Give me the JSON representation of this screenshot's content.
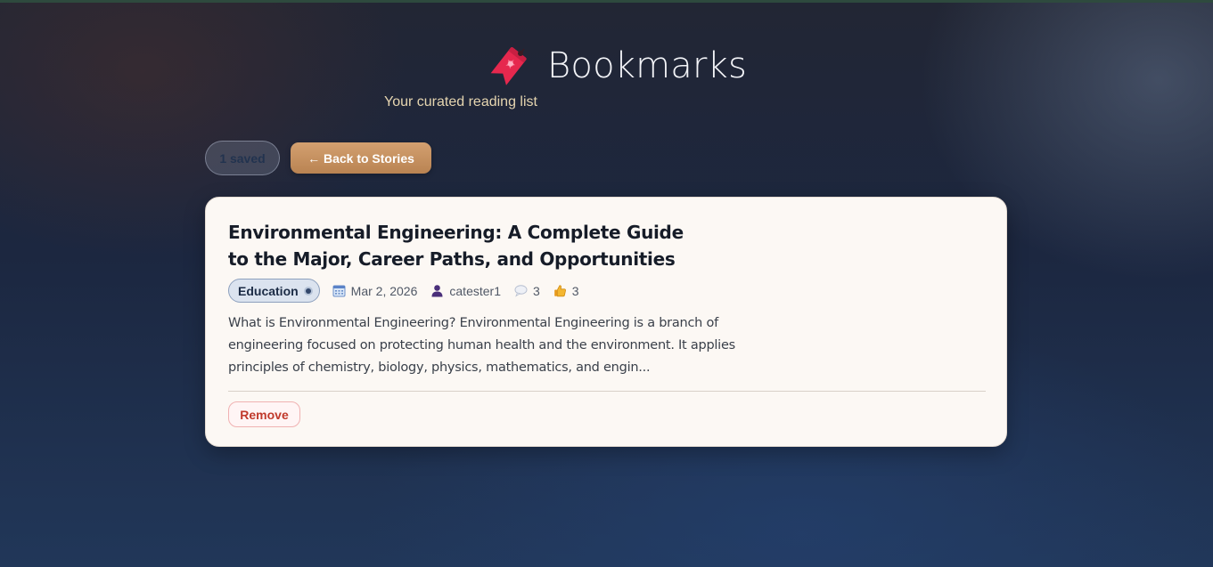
{
  "header": {
    "title": "Bookmarks",
    "subtitle": "Your curated reading list",
    "icon": "bookmark-icon"
  },
  "toolbar": {
    "saved_count": "1 saved",
    "back_label": "← Back to Stories"
  },
  "bookmarks": [
    {
      "title": "Environmental Engineering: A Complete Guide to the Major, Career Paths, and Opportunities",
      "category": "Education",
      "date": "Mar 2, 2026",
      "author": "catester1",
      "comments": "3",
      "likes": "3",
      "excerpt": "What is Environmental Engineering? Environmental Engineering is a branch of engineering focused on protecting human health and the environment. It applies principles of chemistry, biology, physics, mathematics, and engin...",
      "remove_label": "Remove"
    }
  ],
  "colors": {
    "accent": "#c78f5e",
    "remove": "#c0392b",
    "card_bg": "#fcf8f4",
    "subtitle": "#e6d5b0"
  }
}
